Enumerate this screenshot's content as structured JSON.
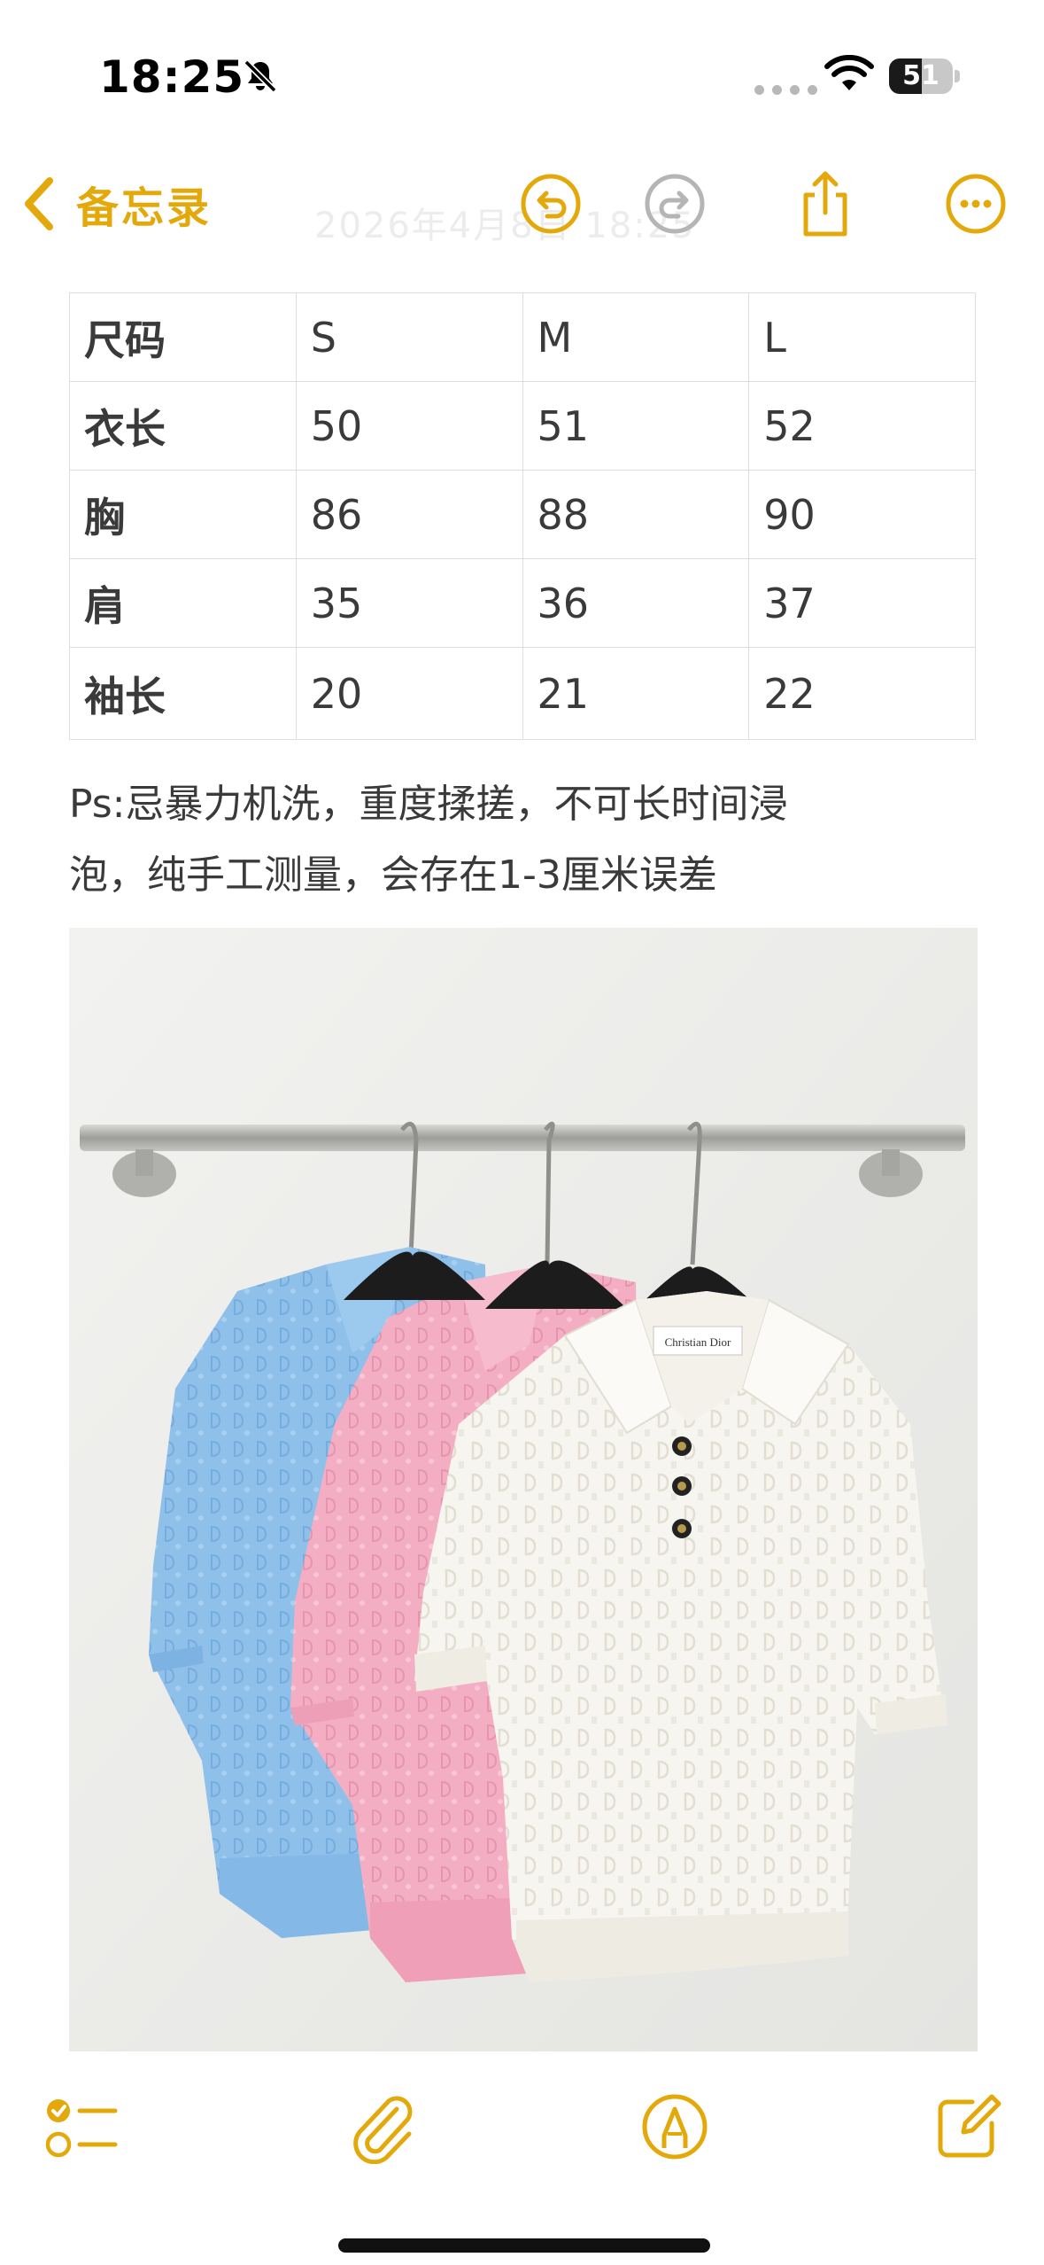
{
  "status_bar": {
    "time": "18:25",
    "battery_level": "51",
    "icons": [
      "bell-slash-icon",
      "cellular-dots-icon",
      "wifi-icon",
      "battery-icon"
    ]
  },
  "nav": {
    "back_label": "备忘录",
    "faint_date": "2026年4月8日 18:25",
    "icons": [
      "chevron-left-icon",
      "undo-icon",
      "redo-icon",
      "share-icon",
      "more-icon"
    ]
  },
  "size_table": {
    "header": [
      "尺码",
      "S",
      "M",
      "L"
    ],
    "rows": [
      [
        "衣长",
        "50",
        "51",
        "52"
      ],
      [
        "胸",
        "86",
        "88",
        "90"
      ],
      [
        "肩",
        "35",
        "36",
        "37"
      ],
      [
        "袖长",
        "20",
        "21",
        "22"
      ]
    ]
  },
  "note": {
    "line1": "Ps:忌暴力机洗，重度揉搓，不可长时间浸",
    "line2": "泡，纯手工测量，会存在1-3厘米误差"
  },
  "photo": {
    "label_text": "Christian Dior",
    "subject": "three knit polo shirts on hangers"
  },
  "toolbar": {
    "icons": [
      "checklist-icon",
      "paperclip-icon",
      "markup-pen-icon",
      "compose-icon"
    ]
  },
  "colors": {
    "accent": "#e3a90a",
    "accent_disabled": "#b5b5b5",
    "text": "#3a3a3a",
    "table_border": "#dedede",
    "shirt_blue": "#8fc0ea",
    "shirt_pink": "#f3aec3",
    "shirt_white": "#f7f5ef"
  }
}
